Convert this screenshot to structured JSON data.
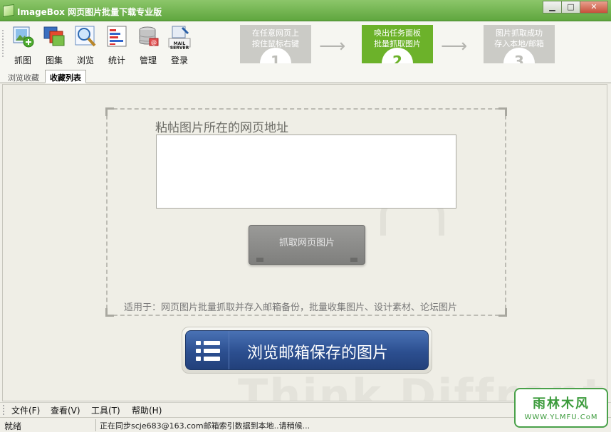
{
  "window": {
    "title": "ImageBox 网页图片批量下载专业版",
    "minimize": "▁",
    "maximize": "□",
    "close": "✕"
  },
  "toolbar": {
    "items": [
      {
        "label": "抓图",
        "icon": "grab-image-icon"
      },
      {
        "label": "图集",
        "icon": "gallery-icon"
      },
      {
        "label": "浏览",
        "icon": "browse-magnifier-icon"
      },
      {
        "label": "统计",
        "icon": "statistics-icon"
      },
      {
        "label": "管理",
        "icon": "manage-database-icon"
      },
      {
        "label": "登录",
        "icon": "mail-server-login-icon"
      }
    ],
    "mail_server_text": "MAIL SERVER"
  },
  "steps": [
    {
      "line1": "在任意网页上",
      "line2": "按住鼠标右键",
      "num": "1"
    },
    {
      "line1": "唤出任务面板",
      "line2": "批量抓取图片",
      "num": "2"
    },
    {
      "line1": "图片抓取成功",
      "line2": "存入本地/邮箱",
      "num": "3"
    }
  ],
  "tabs": [
    {
      "label": "浏览收藏"
    },
    {
      "label": "收藏列表"
    }
  ],
  "main": {
    "url_label": "粘帖图片所在的网页地址",
    "url_value": "",
    "grab_button": "抓取网页图片",
    "usage_text": "适用于：网页图片批量抓取并存入邮箱备份，批量收集图片、设计素材、论坛图片",
    "browse_button": "浏览邮箱保存的图片",
    "watermark": "Think Diffrent"
  },
  "menu": [
    {
      "label": "文件(F)"
    },
    {
      "label": "查看(V)"
    },
    {
      "label": "工具(T)"
    },
    {
      "label": "帮助(H)"
    }
  ],
  "status": {
    "state": "就绪",
    "message": "正在同步scje683@163.com邮箱索引数据到本地..请稍候..."
  },
  "site_logo": {
    "big": "雨林木风",
    "small": "WWW.YLMFU.CoM"
  },
  "colors": {
    "title_green": "#5fa63e",
    "step_active": "#6cb22a",
    "browse_blue": "#2c4f90"
  }
}
